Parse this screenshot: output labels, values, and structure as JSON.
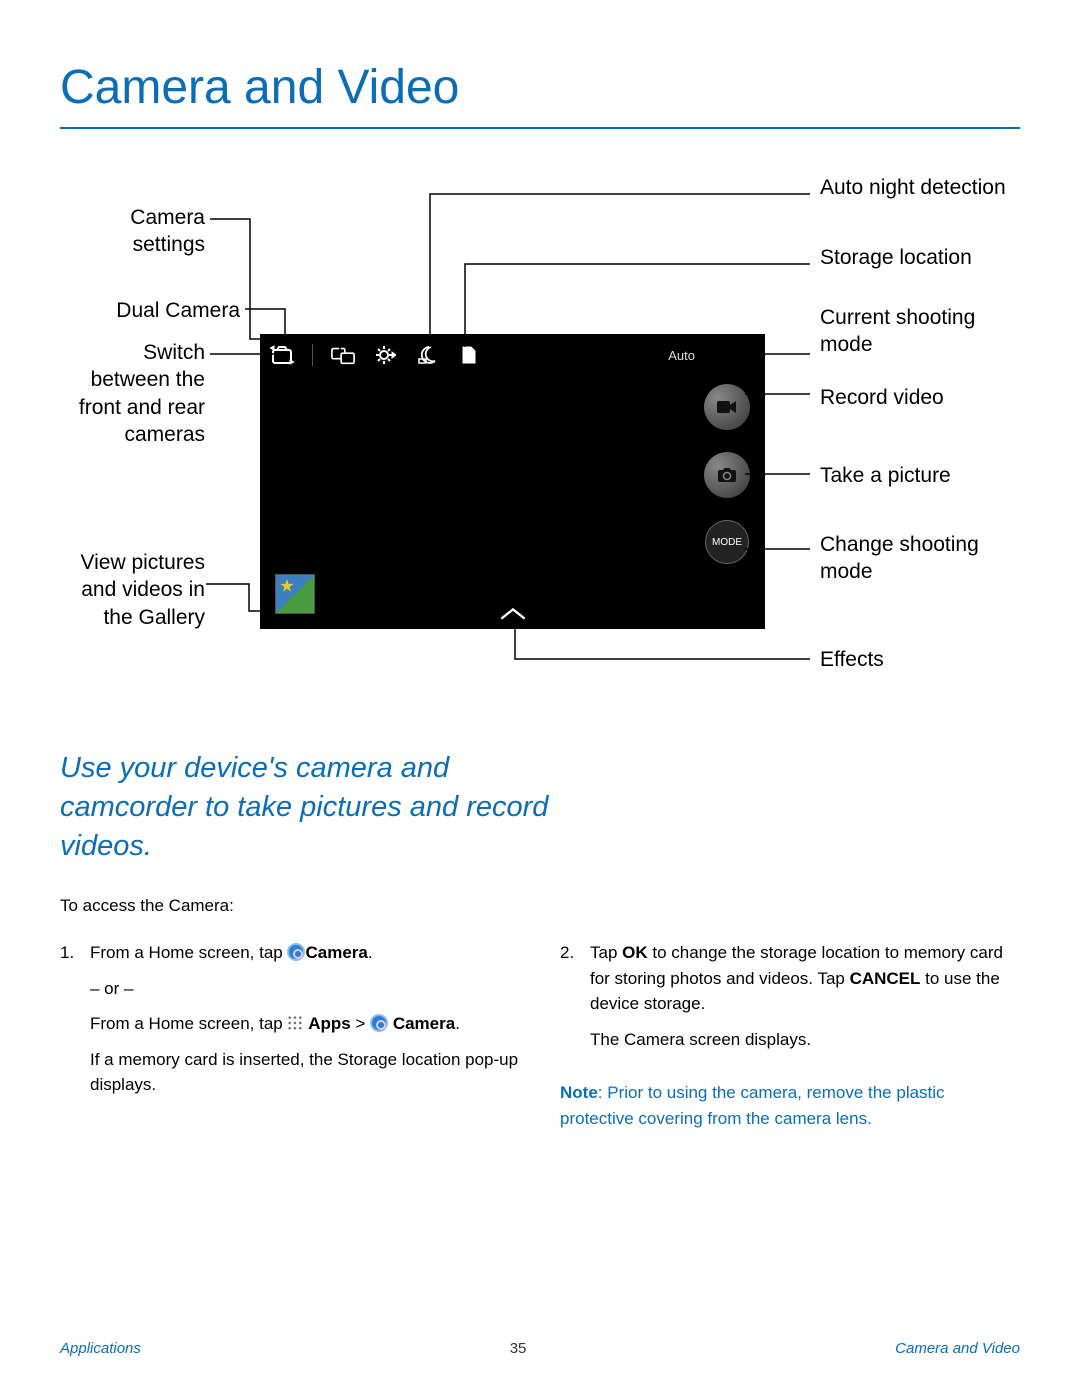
{
  "title": "Camera and Video",
  "callouts": {
    "camera_settings": "Camera settings",
    "dual_camera": "Dual Camera",
    "switch_camera": "Switch between the front and rear cameras",
    "gallery": "View pictures and videos in the Gallery",
    "auto_night": "Auto night detection",
    "storage": "Storage location",
    "current_mode": "Current shooting mode",
    "record": "Record video",
    "take_picture": "Take a picture",
    "change_mode": "Change shooting mode",
    "effects": "Effects"
  },
  "camera_ui": {
    "auto_label": "Auto",
    "mode_label": "MODE"
  },
  "intro": "Use your device's camera and camcorder to take pictures and record videos.",
  "access_heading": "To access the Camera:",
  "steps": {
    "step1": {
      "num": "1.",
      "line1a": "From a Home screen, tap ",
      "camera_bold": "Camera",
      "line1b": ".",
      "or": "– or –",
      "line2a": "From a Home screen, tap ",
      "apps_bold": "Apps",
      "gt": " > ",
      "camera_bold2": "Camera",
      "line2b": ".",
      "line3": "If a memory card is inserted, the Storage location pop-up displays."
    },
    "step2": {
      "num": "2.",
      "line1a": "Tap ",
      "ok_bold": "OK",
      "line1b": " to change the storage location to memory card for storing photos and videos. Tap ",
      "cancel_bold": "CANCEL",
      "line1c": " to use the device storage.",
      "line2": "The Camera screen displays."
    }
  },
  "note": {
    "label": "Note",
    "body": ": Prior to using the camera, remove the plastic protective covering from the camera lens."
  },
  "footer": {
    "left": "Applications",
    "page": "35",
    "right": "Camera and Video"
  }
}
